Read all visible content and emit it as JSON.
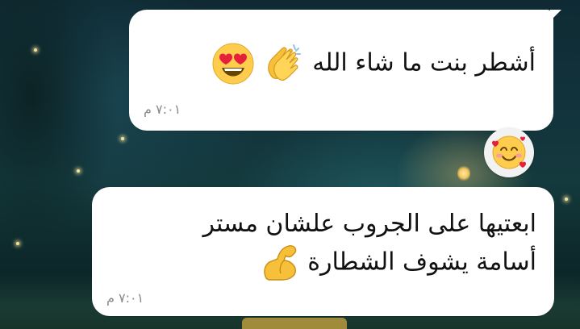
{
  "messages": [
    {
      "text": "أشطر بنت ما شاء الله",
      "emojis": [
        "clapping-hands",
        "heart-eyes-face"
      ],
      "time": "٧:٠١ م",
      "reaction": "smiling-face-with-hearts"
    },
    {
      "lines": [
        "ابعتيها على الجروب علشان مستر",
        "أسامة يشوف الشطارة"
      ],
      "emoji": "flexed-biceps",
      "time": "٧:٠١ م"
    }
  ],
  "colors": {
    "bubble": "#ffffff",
    "text": "#111111",
    "timestamp": "#8a8a8a",
    "wallpaper": "#12343c"
  }
}
